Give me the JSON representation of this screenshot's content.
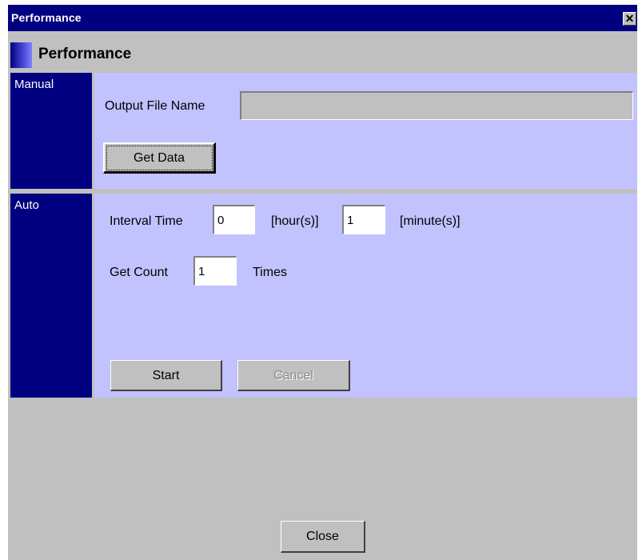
{
  "window": {
    "title": "Performance",
    "close_symbol": "✕",
    "close_icon": "close-icon"
  },
  "header": {
    "title": "Performance"
  },
  "manual": {
    "section_label": "Manual",
    "output_file_label": "Output File Name",
    "output_file_value": "",
    "get_data_label": "Get Data"
  },
  "auto": {
    "section_label": "Auto",
    "interval_label": "Interval Time",
    "hours_value": "0",
    "hours_unit": "[hour(s)]",
    "minutes_value": "1",
    "minutes_unit": "[minute(s)]",
    "count_label": "Get Count",
    "count_value": "1",
    "count_unit": "Times",
    "start_label": "Start",
    "cancel_label": "Cancel"
  },
  "footer": {
    "close_label": "Close"
  },
  "colors": {
    "title_bar": "#000080",
    "section_label_bg": "#000080",
    "panel_bg": "#c2c2ff",
    "window_bg": "#c0c0c0"
  }
}
